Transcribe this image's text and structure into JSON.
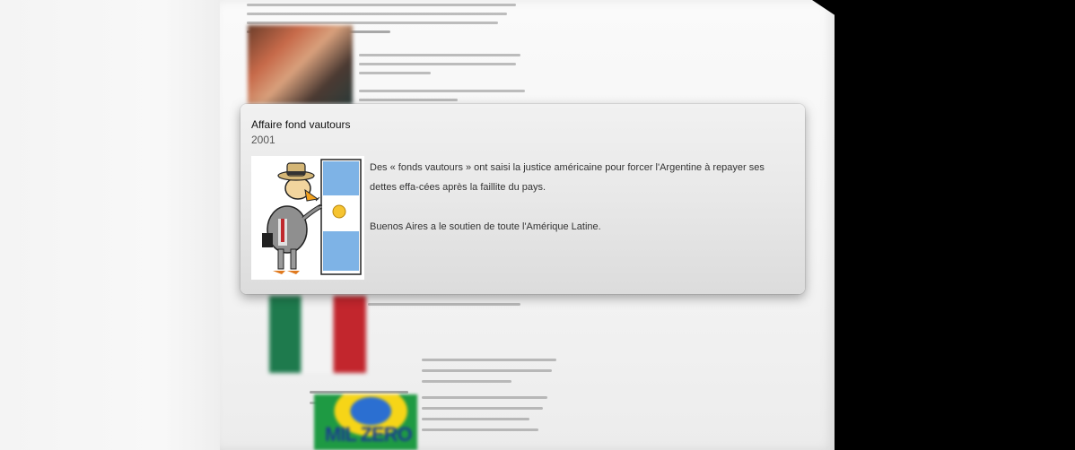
{
  "popup": {
    "title": "Affaire fond vautours",
    "year": "2001",
    "paragraphs": [
      "Des « fonds vautours » ont saisi la justice américaine pour forcer l'Argentine à repayer ses dettes effa-cées après la faillite du pays.",
      "Buenos Aires a le soutien de toute l'Amérique Latine."
    ],
    "image_icon": "vulture-cartoon-image"
  },
  "background": {
    "brazil_banner_text": "MIL ZERO"
  },
  "colors": {
    "popup_bg": "#e9e9e9",
    "page_bg": "#f4f4f4",
    "outer_bg": "#000000"
  }
}
